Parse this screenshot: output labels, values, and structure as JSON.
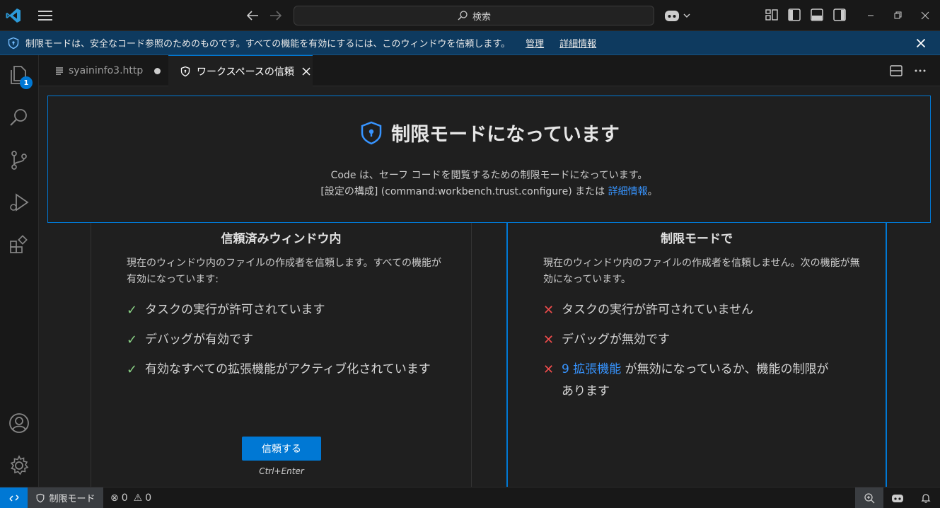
{
  "titlebar": {
    "search_placeholder": "検索"
  },
  "infobar": {
    "message": "制限モードは、安全なコード参照のためのものです。すべての機能を有効にするには、このウィンドウを信頼します。",
    "manage_link": "管理",
    "details_link": "詳細情報"
  },
  "activitybar": {
    "explorer_badge": "1"
  },
  "tabs": [
    {
      "label": "syaininfo3.http",
      "modified": true
    },
    {
      "label": "ワークスペースの信頼",
      "active": true
    }
  ],
  "hero": {
    "title": "制限モードになっています",
    "line1": "Code は、セーフ コードを閲覧するための制限モードになっています。",
    "line2_prefix": "[設定の構成] (command:workbench.trust.configure) または ",
    "line2_link": "詳細情報",
    "line2_suffix": "。"
  },
  "trusted": {
    "title": "信頼済みウィンドウ内",
    "description": "現在のウィンドウ内のファイルの作成者を信頼します。すべての機能が有効になっています:",
    "items": [
      "タスクの実行が許可されています",
      "デバッグが有効です",
      "有効なすべての拡張機能がアクティブ化されています"
    ],
    "button": "信頼する",
    "shortcut": "Ctrl+Enter"
  },
  "restricted": {
    "title": "制限モードで",
    "description": "現在のウィンドウ内のファイルの作成者を信頼しません。次の機能が無効になっています。",
    "items": [
      "タスクの実行が許可されていません",
      "デバッグが無効です"
    ],
    "ext_link": "9 拡張機能",
    "ext_text": " が無効になっているか、機能の制限があります"
  },
  "statusbar": {
    "restricted_label": "制限モード",
    "errors": "0",
    "warnings": "0"
  },
  "colors": {
    "accent": "#0078d4",
    "check": "#89d185",
    "cross": "#f14c4c",
    "link": "#3794ff"
  }
}
